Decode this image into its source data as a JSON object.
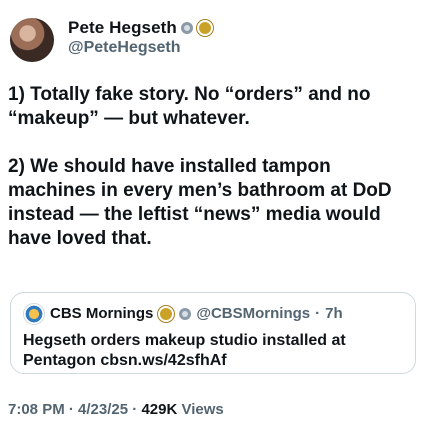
{
  "author": {
    "name": "Pete Hegseth",
    "handle": "@PeteHegseth"
  },
  "tweet": {
    "paragraphs": [
      "1) Totally fake story. No “orders” and no “makeup” — but whatever.",
      "2) We should have installed tampon machines in every men’s bathroom at DoD instead — the leftist “news” media would have loved that."
    ]
  },
  "quoted": {
    "name": "CBS Mornings",
    "handle": "@CBSMornings",
    "separator": "·",
    "time": "7h",
    "text": "Hegseth orders makeup studio installed at Pentagon cbsn.ws/42sfhAf"
  },
  "meta": {
    "time": "7:08 PM",
    "sep1": " · ",
    "date": "4/23/25",
    "sep2": " · ",
    "views_count": "429K",
    "views_label": " Views"
  },
  "colors": {
    "text": "#0f1419",
    "secondary": "#536471",
    "border": "#cfd9de",
    "gold_badge": "#c9a227",
    "gov_badge": "#8a9aa8"
  }
}
